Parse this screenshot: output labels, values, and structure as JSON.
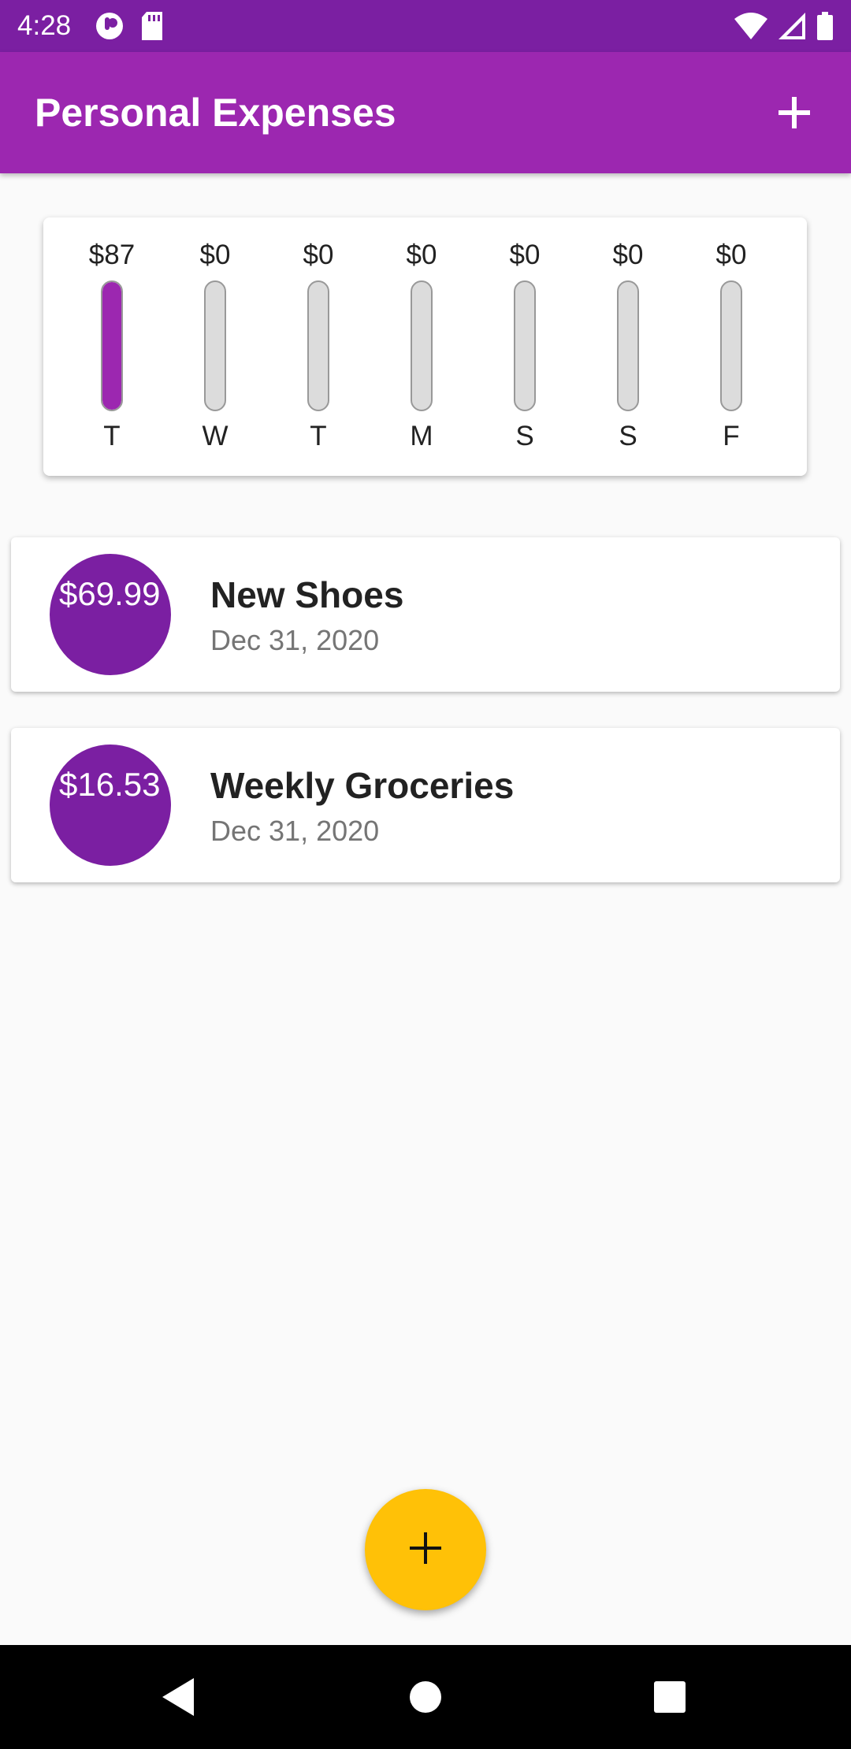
{
  "status_bar": {
    "time": "4:28",
    "icons": [
      "app-notification-icon",
      "sd-card-icon",
      "wifi-icon",
      "signal-icon",
      "battery-icon"
    ]
  },
  "app_bar": {
    "title": "Personal Expenses",
    "action_icon": "add-icon"
  },
  "chart_data": {
    "type": "bar",
    "categories": [
      "T",
      "W",
      "T",
      "M",
      "S",
      "S",
      "F"
    ],
    "values": [
      87,
      0,
      0,
      0,
      0,
      0,
      0
    ],
    "value_labels": [
      "$87",
      "$0",
      "$0",
      "$0",
      "$0",
      "$0",
      "$0"
    ],
    "fill_fractions": [
      1.0,
      0,
      0,
      0,
      0,
      0,
      0
    ]
  },
  "transactions": [
    {
      "amount": "$69.99",
      "title": "New Shoes",
      "date": "Dec 31, 2020"
    },
    {
      "amount": "$16.53",
      "title": "Weekly Groceries",
      "date": "Dec 31, 2020"
    }
  ],
  "fab": {
    "icon": "add-icon"
  },
  "nav_bar": {
    "icons": [
      "back-icon",
      "home-icon",
      "recents-icon"
    ]
  },
  "colors": {
    "status_bar": "#7b1fa2",
    "primary": "#9c27b0",
    "avatar": "#7b1fa2",
    "accent": "#ffc107"
  }
}
